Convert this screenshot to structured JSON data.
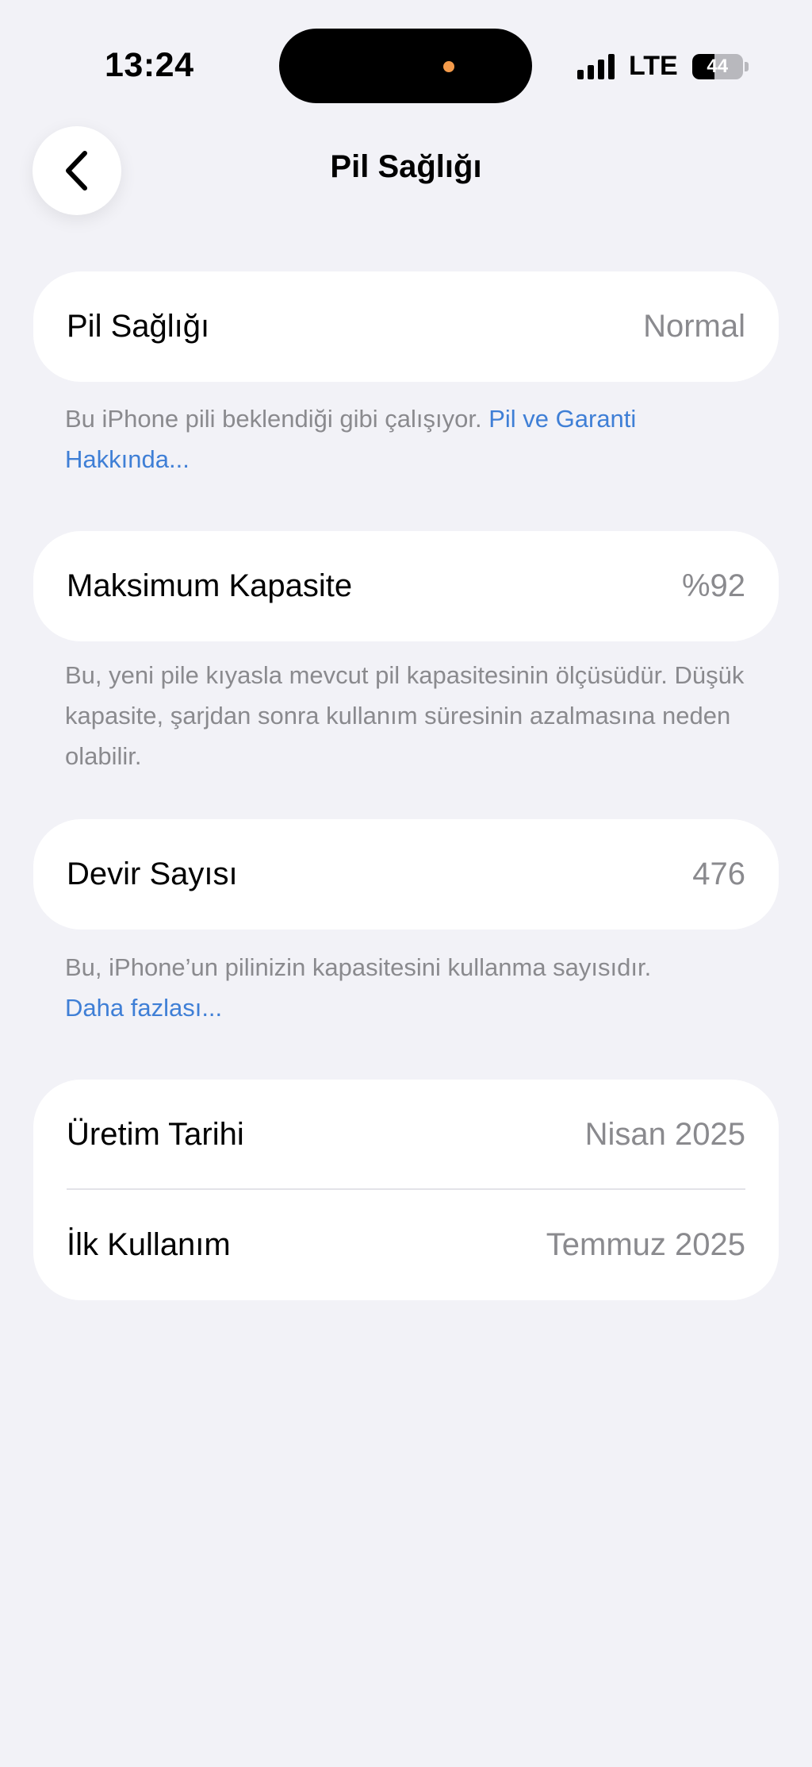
{
  "status_bar": {
    "time": "13:24",
    "network": "LTE",
    "battery": "44",
    "battery_level": 0.44
  },
  "nav": {
    "title": "Pil Sağlığı"
  },
  "battery_health": {
    "label": "Pil Sağlığı",
    "value": "Normal",
    "footnote": "Bu iPhone pili beklendiği gibi çalışıyor.",
    "link": "Pil ve Garanti Hakkında..."
  },
  "max_capacity": {
    "label": "Maksimum Kapasite",
    "value": "%92",
    "footnote": "Bu, yeni pile kıyasla mevcut pil kapasitesinin ölçüsüdür. Düşük kapasite, şarjdan sonra kullanım süresinin azalmasına neden olabilir."
  },
  "cycle_count": {
    "label": "Devir Sayısı",
    "value": "476",
    "footnote": "Bu, iPhone’un pilinizin kapasitesini kullanma sayısıdır.",
    "link": "Daha fazlası..."
  },
  "dates": {
    "manufacture_label": "Üretim Tarihi",
    "manufacture_value": "Nisan 2025",
    "first_use_label": "İlk Kullanım",
    "first_use_value": "Temmuz 2025"
  }
}
